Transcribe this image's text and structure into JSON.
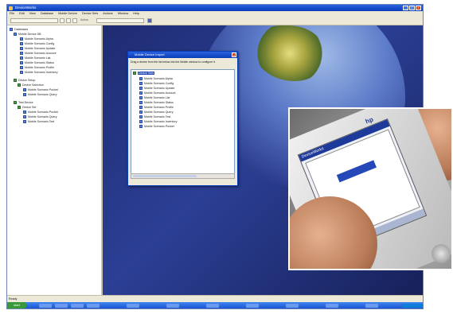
{
  "app": {
    "title": "DeviceWorks",
    "menus": [
      "File",
      "Edit",
      "View",
      "Database",
      "Mobile Device",
      "Device Sets",
      "Actions",
      "Window",
      "Help"
    ],
    "toolbar_text": "Action",
    "statusbar": "Ready"
  },
  "tree": {
    "root": "Databases",
    "group1": "Mobile Device DB",
    "group1_items": [
      "Mobile Scenario Alpha",
      "Mobile Scenario Config",
      "Mobile Scenario Update",
      "Mobile Scenario Account",
      "Mobile Scenario List",
      "Mobile Scenario Status",
      "Mobile Scenario Profile",
      "Mobile Scenario Inventory"
    ],
    "group2": "Device Setup",
    "group2_sub": "Device Selection",
    "group2_items": [
      "Mobile Scenario Pocket",
      "Mobile Scenario Query"
    ],
    "group3": "Test Device",
    "group3_sub": "Device Set",
    "group3_items": [
      "Mobile Scenario Pocket",
      "Mobile Scenario Query",
      "Mobile Scenario Test"
    ]
  },
  "dialog": {
    "title": "Mobile Device Import",
    "instructions": "Drag a device from the list below into the Mobile window to configure it.",
    "root": "Device Sets",
    "items": [
      "Mobile Scenario Alpha",
      "Mobile Scenario Config",
      "Mobile Scenario Update",
      "Mobile Scenario Account",
      "Mobile Scenario List",
      "Mobile Scenario Status",
      "Mobile Scenario Profile",
      "Mobile Scenario Query",
      "Mobile Scenario Test",
      "Mobile Scenario Inventory",
      "Mobile Scenario Pocket"
    ]
  },
  "phone": {
    "brand": "hp",
    "screen_title": "DeviceWorks"
  },
  "colors": {
    "titlebar": "#0a3cb8",
    "desktop": "#2b3f95",
    "taskbar": "#1c55d2"
  }
}
